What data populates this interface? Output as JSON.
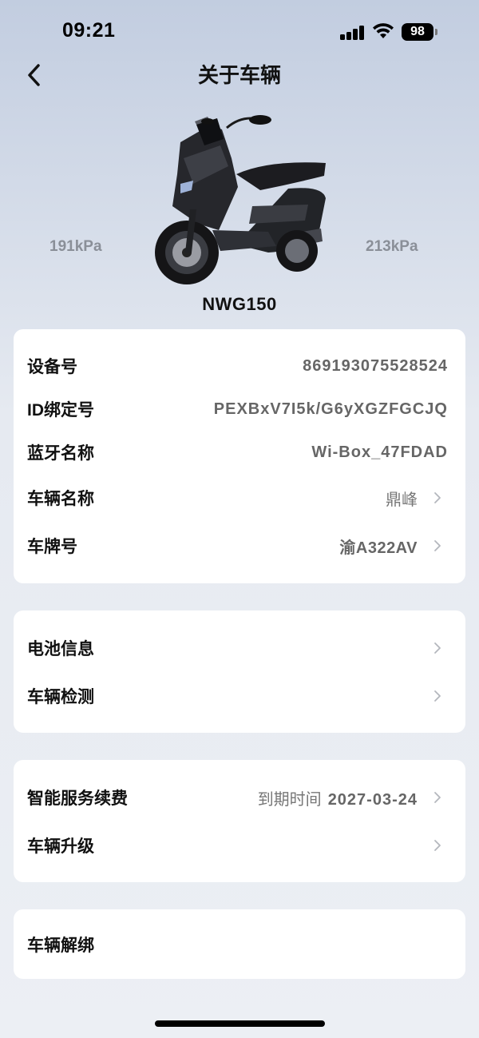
{
  "status_bar": {
    "time": "09:21",
    "battery": "98"
  },
  "header": {
    "title": "关于车辆"
  },
  "vehicle": {
    "front_tire_pressure": "191kPa",
    "rear_tire_pressure": "213kPa",
    "model": "NWG150"
  },
  "info_card": {
    "rows": [
      {
        "label": "设备号",
        "value": "869193075528524"
      },
      {
        "label": "ID绑定号",
        "value": "PEXBxV7I5k/G6yXGZFGCJQ"
      },
      {
        "label": "蓝牙名称",
        "value": "Wi-Box_47FDAD"
      },
      {
        "label": "车辆名称",
        "value": "鼎峰"
      },
      {
        "label": "车牌号",
        "value": "渝A322AV"
      }
    ]
  },
  "device_card": {
    "rows": [
      {
        "label": "电池信息"
      },
      {
        "label": "车辆检测"
      }
    ]
  },
  "service_card": {
    "rows": [
      {
        "label": "智能服务续费",
        "value_prefix": "到期时间",
        "value": "2027-03-24"
      },
      {
        "label": "车辆升级"
      }
    ]
  },
  "unbind_card": {
    "rows": [
      {
        "label": "车辆解绑"
      }
    ]
  },
  "colors": {
    "background_top": "#c2cde0",
    "background_bottom": "#eceff4",
    "card": "#ffffff",
    "label": "#111111",
    "value": "#666666",
    "tire_pressure": "#8a8f98"
  }
}
